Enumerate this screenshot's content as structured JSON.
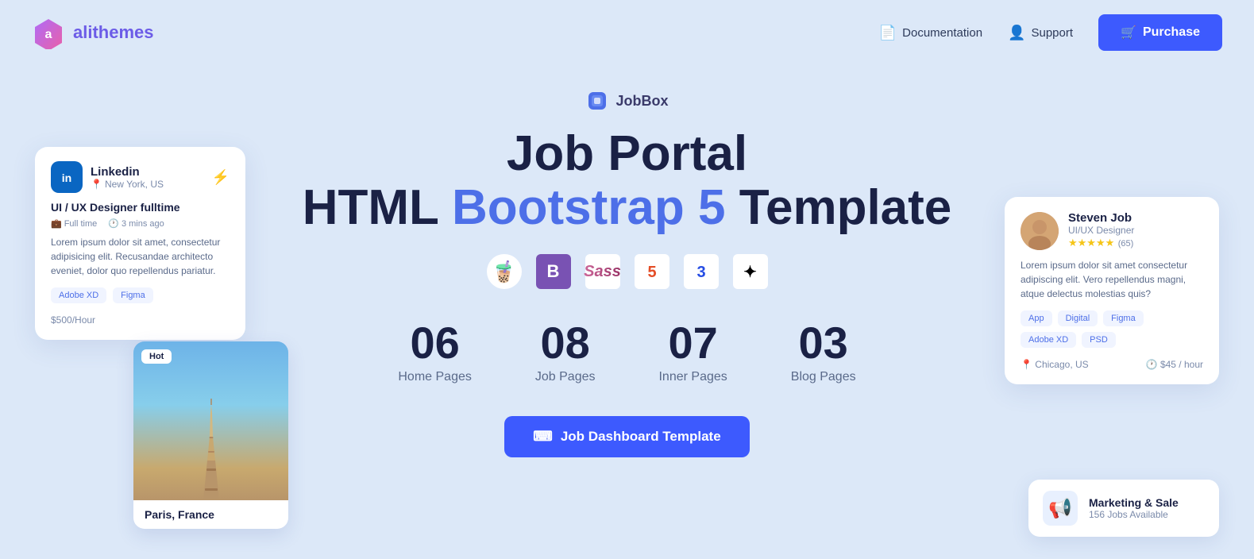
{
  "header": {
    "logo_text_ali": "ali",
    "logo_text_themes": "themes",
    "doc_label": "Documentation",
    "support_label": "Support",
    "purchase_label": "Purchase"
  },
  "hero": {
    "brand_name": "JobBox",
    "title_line1": "Job Portal",
    "title_line2_plain1": "HTML ",
    "title_line2_highlight": "Bootstrap 5",
    "title_line2_plain2": " Template",
    "tech_icons": [
      {
        "name": "bubble",
        "symbol": "🧋"
      },
      {
        "name": "bootstrap",
        "symbol": "B"
      },
      {
        "name": "sass",
        "symbol": "Sass"
      },
      {
        "name": "html5",
        "symbol": "5"
      },
      {
        "name": "css3",
        "symbol": "3"
      },
      {
        "name": "figma",
        "symbol": "✦"
      }
    ]
  },
  "stats": [
    {
      "num": "06",
      "label": "Home Pages"
    },
    {
      "num": "08",
      "label": "Job Pages"
    },
    {
      "num": "07",
      "label": "Inner Pages"
    },
    {
      "num": "03",
      "label": "Blog Pages"
    }
  ],
  "cta": {
    "label": "Job Dashboard Template"
  },
  "left_card": {
    "company": "Linkedin",
    "location": "New York, US",
    "job_title": "UI / UX Designer fulltime",
    "type": "Full time",
    "time": "3 mins ago",
    "description": "Lorem ipsum dolor sit amet, consectetur adipisicing elit. Recusandae architecto eveniet, dolor quo repellendus pariatur.",
    "tags": [
      "Adobe XD",
      "Figma"
    ],
    "price": "$500",
    "per": "/Hour"
  },
  "travel_card": {
    "badge": "Hot",
    "location": "Paris, France"
  },
  "right_card": {
    "name": "Steven Job",
    "role": "UI/UX Designer",
    "stars": "★★★★★",
    "reviews": "(65)",
    "description": "Lorem ipsum dolor sit amet consectetur adipiscing elit. Vero repellendus magni, atque delectus molestias quis?",
    "tags": [
      "App",
      "Digital",
      "Figma",
      "Adobe XD",
      "PSD"
    ],
    "location": "Chicago, US",
    "rate": "$45 / hour"
  },
  "marketing_card": {
    "title": "Marketing & Sale",
    "jobs": "156 Jobs Available"
  }
}
